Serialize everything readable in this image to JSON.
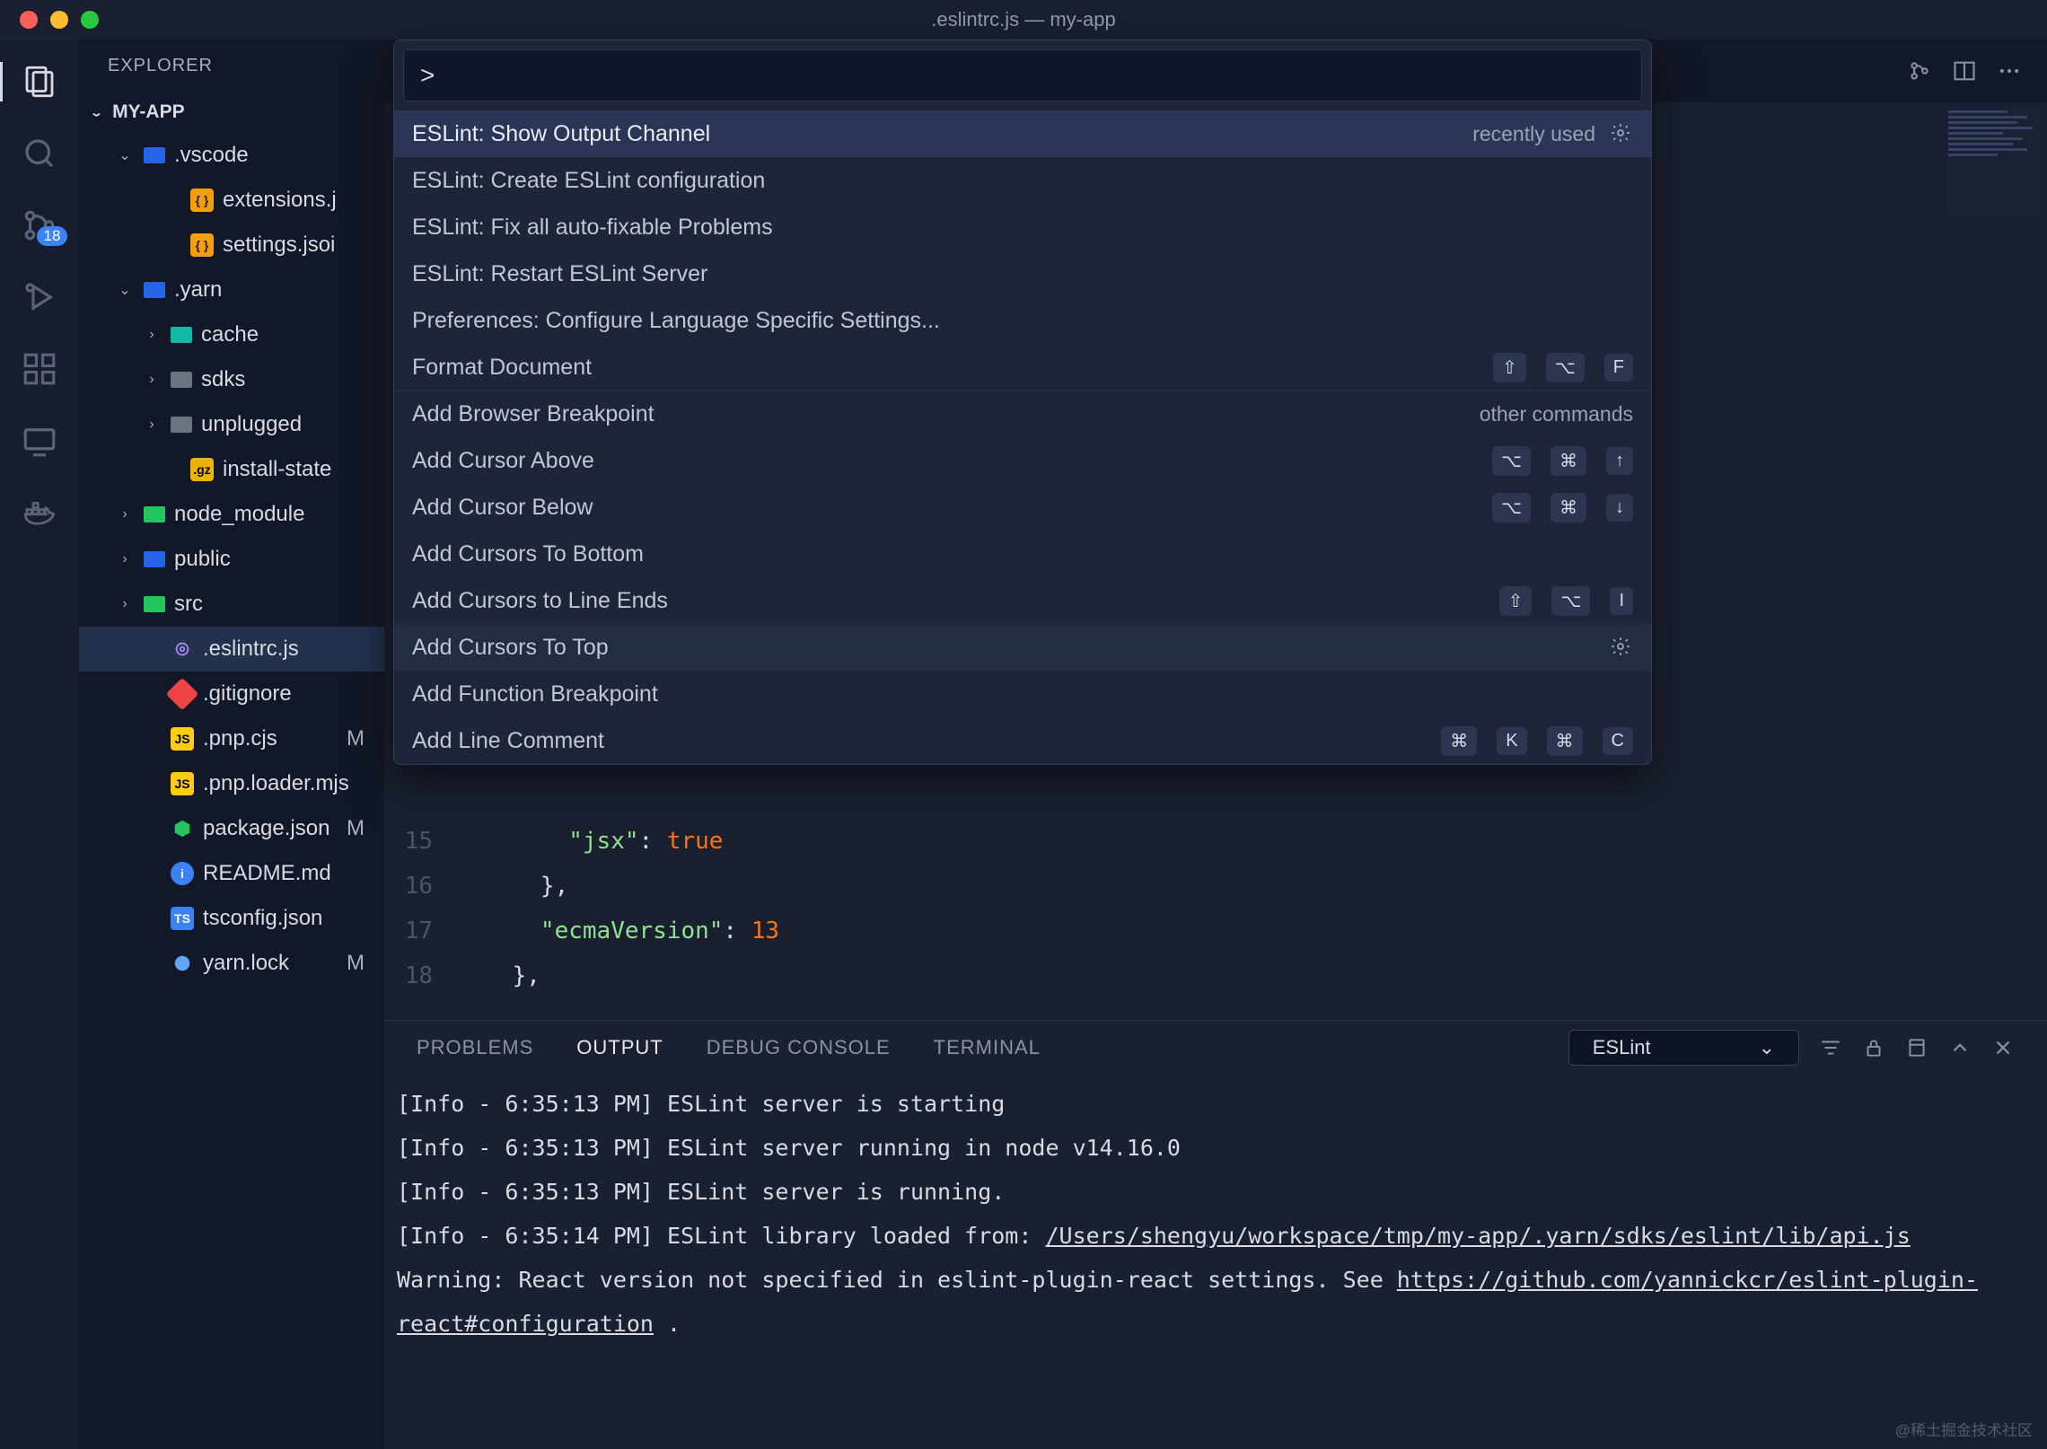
{
  "window": {
    "title": ".eslintrc.js — my-app"
  },
  "explorer": {
    "header": "EXPLORER",
    "section": "MY-APP",
    "tree": [
      {
        "name": ".vscode",
        "kind": "blue-folder",
        "chev": "v",
        "indent": 1
      },
      {
        "name": "extensions.j",
        "kind": "braces",
        "indent": 3,
        "label": "{ }"
      },
      {
        "name": "settings.jsoi",
        "kind": "braces",
        "indent": 3,
        "label": "{ }"
      },
      {
        "name": ".yarn",
        "kind": "blue-folder",
        "chev": "v",
        "indent": 1
      },
      {
        "name": "cache",
        "kind": "teal-folder",
        "chev": ">",
        "indent": 2
      },
      {
        "name": "sdks",
        "kind": "grey-folder",
        "chev": ">",
        "indent": 2
      },
      {
        "name": "unplugged",
        "kind": "grey-folder",
        "chev": ">",
        "indent": 2
      },
      {
        "name": "install-state",
        "kind": "gz",
        "indent": 3,
        "label": ".gz"
      },
      {
        "name": "node_module",
        "kind": "green-folder",
        "chev": ">",
        "indent": 1
      },
      {
        "name": "public",
        "kind": "blue-folder",
        "chev": ">",
        "indent": 1
      },
      {
        "name": "src",
        "kind": "green-folder",
        "chev": ">",
        "indent": 1
      },
      {
        "name": ".eslintrc.js",
        "kind": "gear",
        "indent": 2,
        "sel": true
      },
      {
        "name": ".gitignore",
        "kind": "git",
        "indent": 2
      },
      {
        "name": ".pnp.cjs",
        "kind": "js",
        "indent": 2,
        "label": "JS",
        "m": "M"
      },
      {
        "name": ".pnp.loader.mjs",
        "kind": "js",
        "indent": 2,
        "label": "JS"
      },
      {
        "name": "package.json",
        "kind": "node",
        "indent": 2,
        "m": "M"
      },
      {
        "name": "README.md",
        "kind": "info",
        "indent": 2,
        "label": "i"
      },
      {
        "name": "tsconfig.json",
        "kind": "ts",
        "indent": 2,
        "label": "TS"
      },
      {
        "name": "yarn.lock",
        "kind": "yarn",
        "indent": 2,
        "m": "M"
      }
    ]
  },
  "scm_badge": "18",
  "palette": {
    "prompt": ">",
    "rows": [
      {
        "label": "ESLint: Show Output Channel",
        "meta": "recently used",
        "gear": true,
        "hi": true
      },
      {
        "label": "ESLint: Create ESLint configuration"
      },
      {
        "label": "ESLint: Fix all auto-fixable Problems"
      },
      {
        "label": "ESLint: Restart ESLint Server"
      },
      {
        "label": "Preferences: Configure Language Specific Settings..."
      },
      {
        "label": "Format Document",
        "keys": [
          "⇧",
          "⌥",
          "F"
        ]
      },
      {
        "label": "Add Browser Breakpoint",
        "meta": "other commands",
        "cat": true
      },
      {
        "label": "Add Cursor Above",
        "keys": [
          "⌥",
          "⌘",
          "↑"
        ]
      },
      {
        "label": "Add Cursor Below",
        "keys": [
          "⌥",
          "⌘",
          "↓"
        ]
      },
      {
        "label": "Add Cursors To Bottom"
      },
      {
        "label": "Add Cursors to Line Ends",
        "keys": [
          "⇧",
          "⌥",
          "I"
        ]
      },
      {
        "label": "Add Cursors To Top",
        "gear": true,
        "hover": true
      },
      {
        "label": "Add Function Breakpoint"
      },
      {
        "label": "Add Line Comment",
        "keys": [
          "⌘",
          "K",
          "⌘",
          "C"
        ]
      }
    ]
  },
  "editor": {
    "lines": [
      {
        "no": "15",
        "html": "        <span class='tok-key'>\"jsx\"</span><span class='tok-punc'>:</span> <span class='tok-bool'>true</span>"
      },
      {
        "no": "16",
        "html": "      <span class='tok-punc'>},</span>"
      },
      {
        "no": "17",
        "html": "      <span class='tok-key'>\"ecmaVersion\"</span><span class='tok-punc'>:</span> <span class='tok-num'>13</span>"
      },
      {
        "no": "18",
        "html": "    <span class='tok-punc'>},</span>"
      }
    ]
  },
  "panel": {
    "tabs": {
      "problems": "PROBLEMS",
      "output": "OUTPUT",
      "debug": "DEBUG CONSOLE",
      "terminal": "TERMINAL"
    },
    "channel": "ESLint",
    "output": [
      "[Info  - 6:35:13 PM] ESLint server is starting",
      "[Info  - 6:35:13 PM] ESLint server running in node v14.16.0",
      "[Info  - 6:35:13 PM] ESLint server is running.",
      "[Info  - 6:35:14 PM] ESLint library loaded from: <span class='ul'>/Users/shengyu/workspace/tmp/my-app/.yarn/sdks/eslint/lib/api.js</span>",
      "Warning: React version not specified in eslint-plugin-react settings. See <span class='ul'>https://github.com/yannickcr/eslint-plugin-react#configuration</span> ."
    ]
  },
  "watermark": "@稀土掘金技术社区"
}
